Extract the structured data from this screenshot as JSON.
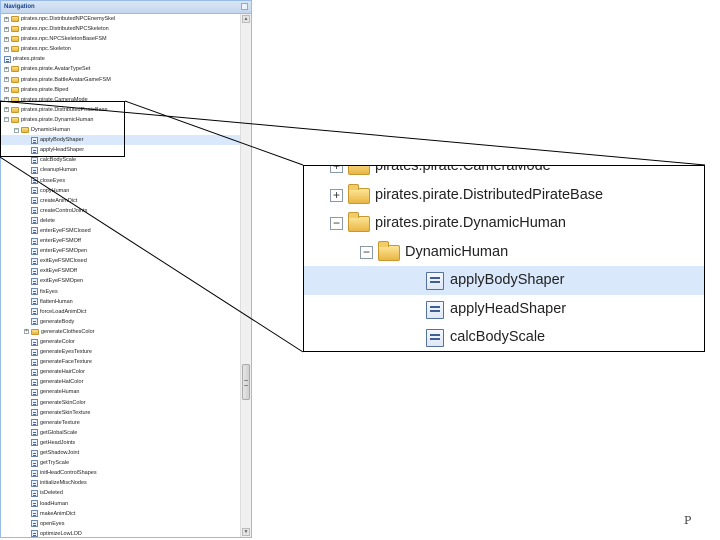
{
  "nav": {
    "title": "Navigation",
    "tree": [
      {
        "label": "pirates.npc.DistributedNPCEnemySkel",
        "kind": "package",
        "depth": 0
      },
      {
        "label": "pirates.npc.DistributedNPCSkeleton",
        "kind": "package",
        "depth": 0
      },
      {
        "label": "pirates.npc.NPCSkeletonBaseFSM",
        "kind": "package",
        "depth": 0
      },
      {
        "label": "pirates.npc.Skeleton",
        "kind": "package",
        "depth": 0
      },
      {
        "label": "pirates.pirate",
        "kind": "leaf",
        "depth": 0
      },
      {
        "label": "pirates.pirate.AvatarTypeSet",
        "kind": "package",
        "depth": 0
      },
      {
        "label": "pirates.pirate.BattleAvatarGameFSM",
        "kind": "package",
        "depth": 0
      },
      {
        "label": "pirates.pirate.Biped",
        "kind": "package",
        "depth": 0
      },
      {
        "label": "pirates.pirate.CameraMode",
        "kind": "package",
        "depth": 0
      },
      {
        "label": "pirates.pirate.DistributedPirateBase",
        "kind": "package",
        "depth": 0
      },
      {
        "label": "pirates.pirate.DynamicHuman",
        "kind": "package-open",
        "depth": 0
      },
      {
        "label": "DynamicHuman",
        "kind": "class-open",
        "depth": 1
      },
      {
        "label": "applyBodyShaper",
        "kind": "leaf",
        "depth": 2,
        "selected": true
      },
      {
        "label": "applyHeadShaper",
        "kind": "leaf",
        "depth": 2
      },
      {
        "label": "calcBodyScale",
        "kind": "leaf",
        "depth": 2
      },
      {
        "label": "cleanupHuman",
        "kind": "leaf",
        "depth": 2
      },
      {
        "label": "closeEyes",
        "kind": "leaf",
        "depth": 2
      },
      {
        "label": "copyHuman",
        "kind": "leaf",
        "depth": 2
      },
      {
        "label": "createAnimDict",
        "kind": "leaf",
        "depth": 2
      },
      {
        "label": "createControlJoints",
        "kind": "leaf",
        "depth": 2
      },
      {
        "label": "delete",
        "kind": "leaf",
        "depth": 2
      },
      {
        "label": "enterEyeFSMClosed",
        "kind": "leaf",
        "depth": 2
      },
      {
        "label": "enterEyeFSMOff",
        "kind": "leaf",
        "depth": 2
      },
      {
        "label": "enterEyeFSMOpen",
        "kind": "leaf",
        "depth": 2
      },
      {
        "label": "exitEyeFSMClosed",
        "kind": "leaf",
        "depth": 2
      },
      {
        "label": "exitEyeFSMOff",
        "kind": "leaf",
        "depth": 2
      },
      {
        "label": "exitEyeFSMOpen",
        "kind": "leaf",
        "depth": 2
      },
      {
        "label": "fixEyes",
        "kind": "leaf",
        "depth": 2
      },
      {
        "label": "flattenHuman",
        "kind": "leaf",
        "depth": 2
      },
      {
        "label": "forceLoadAnimDict",
        "kind": "leaf",
        "depth": 2
      },
      {
        "label": "generateBody",
        "kind": "leaf",
        "depth": 2
      },
      {
        "label": "generateClothesColor",
        "kind": "package",
        "depth": 2
      },
      {
        "label": "generateColor",
        "kind": "leaf",
        "depth": 2
      },
      {
        "label": "generateEyesTexture",
        "kind": "leaf",
        "depth": 2
      },
      {
        "label": "generateFaceTexture",
        "kind": "leaf",
        "depth": 2
      },
      {
        "label": "generateHairColor",
        "kind": "leaf",
        "depth": 2
      },
      {
        "label": "generateHatColor",
        "kind": "leaf",
        "depth": 2
      },
      {
        "label": "generateHuman",
        "kind": "leaf",
        "depth": 2
      },
      {
        "label": "generateSkinColor",
        "kind": "leaf",
        "depth": 2
      },
      {
        "label": "generateSkinTexture",
        "kind": "leaf",
        "depth": 2
      },
      {
        "label": "generateTexture",
        "kind": "leaf",
        "depth": 2
      },
      {
        "label": "getGlobalScale",
        "kind": "leaf",
        "depth": 2
      },
      {
        "label": "getHeadJoints",
        "kind": "leaf",
        "depth": 2
      },
      {
        "label": "getShadowJoint",
        "kind": "leaf",
        "depth": 2
      },
      {
        "label": "getTryScale",
        "kind": "leaf",
        "depth": 2
      },
      {
        "label": "initHeadControlShapes",
        "kind": "leaf",
        "depth": 2
      },
      {
        "label": "initializeMiscNodes",
        "kind": "leaf",
        "depth": 2
      },
      {
        "label": "isDeleted",
        "kind": "leaf",
        "depth": 2
      },
      {
        "label": "loadHuman",
        "kind": "leaf",
        "depth": 2
      },
      {
        "label": "makeAnimDict",
        "kind": "leaf",
        "depth": 2
      },
      {
        "label": "openEyes",
        "kind": "leaf",
        "depth": 2
      },
      {
        "label": "optimizeLowLOD",
        "kind": "leaf",
        "depth": 2
      }
    ]
  },
  "zoom": {
    "rows": [
      {
        "label": "pirates.pirate.CameraMode",
        "kind": "package",
        "depth": 0,
        "cut": true
      },
      {
        "label": "pirates.pirate.DistributedPirateBase",
        "kind": "package",
        "depth": 0
      },
      {
        "label": "pirates.pirate.DynamicHuman",
        "kind": "package-open",
        "depth": 0
      },
      {
        "label": "DynamicHuman",
        "kind": "class-open",
        "depth": 1
      },
      {
        "label": "applyBodyShaper",
        "kind": "leaf",
        "depth": 2,
        "selected": true
      },
      {
        "label": "applyHeadShaper",
        "kind": "leaf",
        "depth": 2
      },
      {
        "label": "calcBodyScale",
        "kind": "leaf",
        "depth": 2
      }
    ]
  },
  "page_marker": "P",
  "colors": {
    "selection": "#d9e8fb",
    "panel_border": "#99bbe8",
    "folder": "#e8b640"
  }
}
